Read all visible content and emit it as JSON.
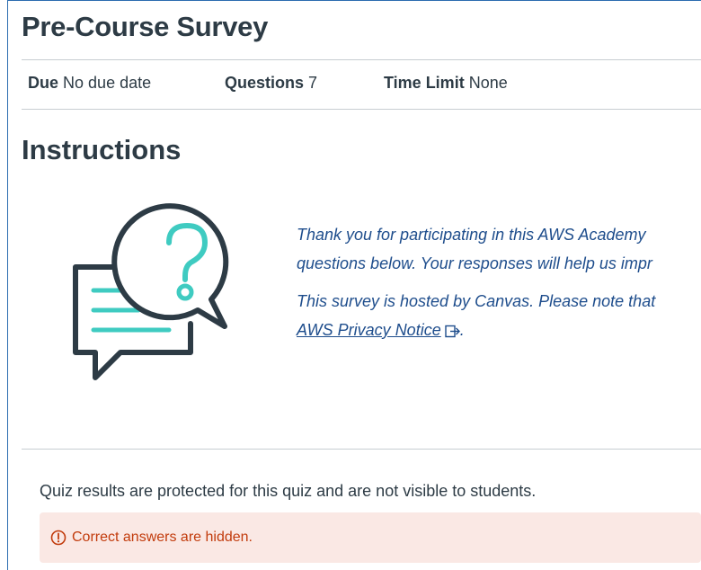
{
  "page": {
    "title": "Pre-Course Survey"
  },
  "meta": {
    "due_label": "Due",
    "due_value": "No due date",
    "questions_label": "Questions",
    "questions_value": "7",
    "time_limit_label": "Time Limit",
    "time_limit_value": "None"
  },
  "instructions": {
    "heading": "Instructions",
    "illustration_icon": "question-chat-bubble-icon",
    "line1": "Thank you for participating in this AWS Academy",
    "line2": "questions below. Your responses will help us impr",
    "line3": "This survey is hosted by Canvas. Please note that",
    "privacy_link": "AWS Privacy Notice",
    "privacy_trailer": "."
  },
  "results": {
    "protected_text": "Quiz results are protected for this quiz and are not visible to students.",
    "alert_text": "Correct answers are hidden.",
    "alert_icon": "warning-circle-icon"
  },
  "colors": {
    "teal": "#3fcbc1",
    "navy": "#2d3b45",
    "link": "#1e4d8c",
    "alert_bg": "#fae8e4",
    "alert_text": "#c23c0d"
  }
}
